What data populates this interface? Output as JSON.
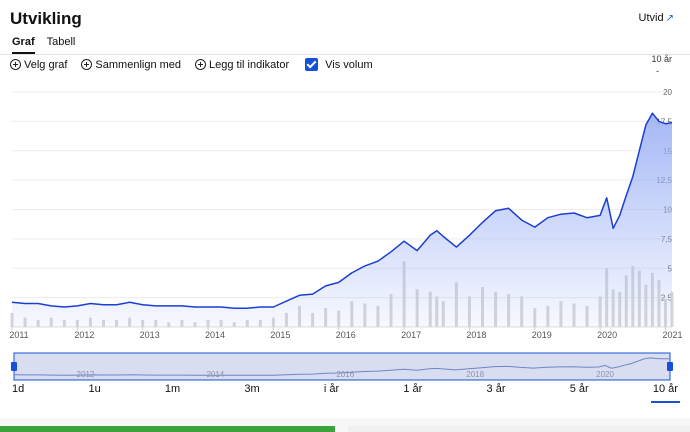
{
  "header": {
    "title": "Utvikling",
    "expand_label": "Utvid",
    "expand_icon": "expand-arrow-icon"
  },
  "tabs": [
    {
      "label": "Graf",
      "active": true
    },
    {
      "label": "Tabell",
      "active": false
    }
  ],
  "toolbar": {
    "select_chart": "Velg graf",
    "compare": "Sammenlign med",
    "add_indicator": "Legg til indikator",
    "show_volume": "Vis volum",
    "show_volume_checked": true,
    "period_label": "10 år",
    "period_dash": "-"
  },
  "colors": {
    "line": "#1a3fd1",
    "fill_top": "#9bb0f5",
    "volume": "#d6d6d6",
    "accent": "#1450d8"
  },
  "chart_data": {
    "type": "area",
    "title": "",
    "xlabel": "",
    "ylabel": "",
    "x_ticks": [
      "2011",
      "2012",
      "2013",
      "2014",
      "2015",
      "2016",
      "2017",
      "2018",
      "2019",
      "2020",
      "2021"
    ],
    "y_ticks": [
      "2,5",
      "5",
      "7,5",
      "10",
      "12,5",
      "15",
      "17,5",
      "20"
    ],
    "ylim": [
      0,
      20
    ],
    "xlim": [
      2011.0,
      2021.1
    ],
    "grid": true,
    "series": [
      {
        "x": [
          2011.0,
          2011.2,
          2011.4,
          2011.6,
          2011.8,
          2012.0,
          2012.2,
          2012.4,
          2012.6,
          2012.8,
          2013.0,
          2013.2,
          2013.4,
          2013.6,
          2013.8,
          2014.0,
          2014.2,
          2014.4,
          2014.6,
          2014.8,
          2015.0,
          2015.2,
          2015.4,
          2015.6,
          2015.8,
          2016.0,
          2016.2,
          2016.4,
          2016.6,
          2016.8,
          2017.0,
          2017.2,
          2017.4,
          2017.5,
          2017.6,
          2017.8,
          2018.0,
          2018.2,
          2018.4,
          2018.6,
          2018.8,
          2019.0,
          2019.2,
          2019.4,
          2019.6,
          2019.8,
          2020.0,
          2020.1,
          2020.2,
          2020.3,
          2020.4,
          2020.5,
          2020.6,
          2020.7,
          2020.8,
          2020.9,
          2021.0,
          2021.1
        ],
        "values": [
          2.1,
          2.0,
          2.0,
          1.8,
          1.7,
          1.8,
          2.0,
          1.9,
          1.9,
          2.1,
          1.9,
          1.8,
          1.8,
          1.8,
          1.7,
          1.7,
          1.7,
          1.6,
          1.6,
          1.7,
          1.7,
          2.2,
          2.7,
          2.8,
          3.5,
          3.8,
          4.6,
          5.2,
          5.6,
          6.4,
          7.3,
          6.5,
          7.8,
          8.2,
          7.7,
          6.8,
          7.8,
          8.9,
          9.9,
          10.1,
          9.1,
          8.5,
          9.3,
          9.6,
          9.7,
          9.3,
          9.5,
          11.0,
          8.4,
          9.5,
          11.2,
          12.8,
          15.0,
          17.2,
          18.2,
          17.5,
          17.3,
          17.4
        ]
      }
    ],
    "volume": [
      0.6,
      0.4,
      0.3,
      0.4,
      0.3,
      0.3,
      0.4,
      0.3,
      0.3,
      0.4,
      0.3,
      0.3,
      0.2,
      0.3,
      0.2,
      0.3,
      0.3,
      0.2,
      0.3,
      0.3,
      0.4,
      0.6,
      0.9,
      0.6,
      0.8,
      0.7,
      1.1,
      1.0,
      0.9,
      1.4,
      2.8,
      1.6,
      1.5,
      1.3,
      1.1,
      1.9,
      1.3,
      1.7,
      1.5,
      1.4,
      1.3,
      0.8,
      0.9,
      1.1,
      1.0,
      0.9,
      1.3,
      2.5,
      1.6,
      1.5,
      2.2,
      2.6,
      2.4,
      1.8,
      2.3,
      2.0,
      1.2,
      1.5
    ]
  },
  "navigator": {
    "year_labels": [
      "2012",
      "2014",
      "2016",
      "2018",
      "2020"
    ]
  },
  "range_options": [
    {
      "label": "1d",
      "active": false
    },
    {
      "label": "1u",
      "active": false
    },
    {
      "label": "1m",
      "active": false
    },
    {
      "label": "3m",
      "active": false
    },
    {
      "label": "i år",
      "active": false
    },
    {
      "label": "1 år",
      "active": false
    },
    {
      "label": "3 år",
      "active": false
    },
    {
      "label": "5 år",
      "active": false
    },
    {
      "label": "10 år",
      "active": true
    }
  ]
}
